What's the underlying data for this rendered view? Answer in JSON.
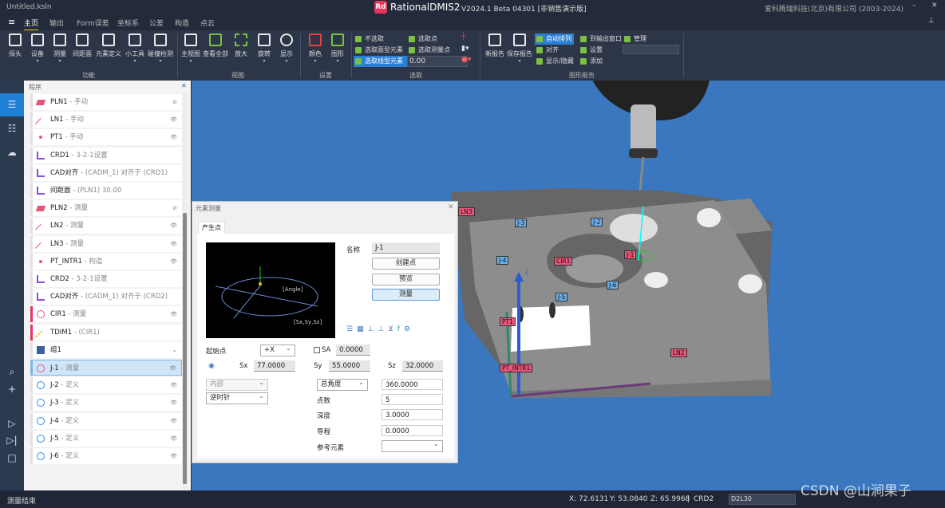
{
  "window": {
    "file": "Untitled.ksln",
    "app": "RationalDMIS2",
    "version": "V2024.1 Beta 04301 [非销售演示版]",
    "company": "爱科腾瑞科技(北京)有限公司 (2003-2024)",
    "minimize": "–",
    "close": "✕"
  },
  "menu": {
    "tabs": [
      "主页",
      "输出",
      "Form误差",
      "坐标系",
      "公差",
      "构造",
      "点云"
    ],
    "active": 0
  },
  "ribbon": {
    "groups": [
      {
        "label": "功能",
        "buttons": [
          "探头",
          "设备",
          "测量",
          "间距面",
          "元素定义",
          "小工具",
          "碰撞检测"
        ]
      },
      {
        "label": "视图",
        "buttons": [
          "主视图",
          "查看全部",
          "放大",
          "旋转",
          "显示"
        ]
      },
      {
        "label": "设置",
        "buttons": [
          "颜色",
          "图形"
        ]
      },
      {
        "label": "选取",
        "items": [
          "不选取",
          "选取点",
          "选取面型元素",
          "选取测量点",
          "选取线型元素"
        ],
        "value": "0.00"
      },
      {
        "label": "图形报告",
        "buttons": [
          "新报告",
          "保存报告"
        ],
        "items": [
          "自动排列",
          "到输出窗口",
          "管理",
          "对齐",
          "设置",
          "显示/隐藏",
          "添加"
        ]
      }
    ]
  },
  "panel": {
    "title": "程序",
    "close": "✕",
    "items": [
      {
        "name": "PLN1",
        "desc": " - 手动",
        "icon": "plane-icon",
        "color": "#e8557a",
        "eye": "hidden"
      },
      {
        "name": "LN1",
        "desc": " - 手动",
        "icon": "line-icon",
        "color": "#e8557a",
        "eye": "visible"
      },
      {
        "name": "PT1",
        "desc": " - 手动",
        "icon": "point-icon",
        "color": "#e8557a",
        "eye": "visible"
      },
      {
        "name": "CRD1",
        "desc": " - 3-2-1设置",
        "icon": "axes-icon",
        "color": "#8a4fe0"
      },
      {
        "name": "CAD对齐",
        "desc": " - (CADM_1) 对齐于 (CRD1)",
        "icon": "cad-align-icon",
        "color": "#8a4fe0"
      },
      {
        "name": "间距面",
        "desc": " - (PLN1) 30.00",
        "icon": "offset-plane-icon",
        "color": "#8a4fe0"
      },
      {
        "name": "PLN2",
        "desc": " - 测量",
        "icon": "plane-icon",
        "color": "#e8557a",
        "eye": "hidden"
      },
      {
        "name": "LN2",
        "desc": " - 测量",
        "icon": "line-icon",
        "color": "#e8557a",
        "eye": "visible"
      },
      {
        "name": "LN3",
        "desc": " - 测量",
        "icon": "line-icon",
        "color": "#e8557a",
        "eye": "visible"
      },
      {
        "name": "PT_INTR1",
        "desc": " - 构造",
        "icon": "point-icon",
        "color": "#e8557a",
        "eye": "visible"
      },
      {
        "name": "CRD2",
        "desc": " - 3-2-1设置",
        "icon": "axes-icon",
        "color": "#8a4fe0"
      },
      {
        "name": "CAD对齐",
        "desc": " - (CADM_1) 对齐于 (CRD2)",
        "icon": "cad-align-icon",
        "color": "#8a4fe0"
      },
      {
        "name": "CIR1",
        "desc": " - 测量",
        "icon": "circle-icon",
        "color": "#e8557a",
        "eye": "visible",
        "flag": true
      },
      {
        "name": "TDIM1",
        "desc": " - (CIR1)",
        "icon": "ruler-icon",
        "color": "#f0b000",
        "flag": true
      },
      {
        "name": "组1",
        "desc": "",
        "icon": "group-icon",
        "color": "#3b5fa0",
        "chevron": "⌄"
      },
      {
        "name": "J-1",
        "desc": " - 测量",
        "icon": "circle-icon",
        "color": "#e8557a",
        "eye": "visible",
        "active": true
      },
      {
        "name": "J-2",
        "desc": " - 定义",
        "icon": "circle-icon",
        "color": "#2f8fe0",
        "eye": "visible"
      },
      {
        "name": "J-3",
        "desc": " - 定义",
        "icon": "circle-icon",
        "color": "#2f8fe0",
        "eye": "visible"
      },
      {
        "name": "J-4",
        "desc": " - 定义",
        "icon": "circle-icon",
        "color": "#2f8fe0",
        "eye": "visible"
      },
      {
        "name": "J-5",
        "desc": " - 定义",
        "icon": "circle-icon",
        "color": "#2f8fe0",
        "eye": "visible"
      },
      {
        "name": "J-6",
        "desc": " - 定义",
        "icon": "circle-icon",
        "color": "#2f8fe0",
        "eye": "visible"
      }
    ]
  },
  "view": {
    "labels_red": [
      "LN3",
      "CIR1",
      "J-1",
      "PT1",
      "PT_INTR1",
      "LN2"
    ],
    "labels_blue": [
      "J-3",
      "J-2",
      "J-4",
      "J-6",
      "J-5"
    ],
    "axis_z": "Z",
    "background": "#3b77be"
  },
  "dialog": {
    "title": "元素测量",
    "close": "✕",
    "tab": "产生点",
    "preview_angle": "[Angle]",
    "preview_start": "[Sx,Sy,Sz]",
    "name_label": "名称",
    "name_value": "J-1",
    "create_points": "创建点",
    "preview": "预览",
    "measure": "测量",
    "start_label": "起始点",
    "start_value": "+X",
    "sa_label": "SA",
    "sa_value": "0.0000",
    "sx_label": "Sx",
    "sx": "77.0000",
    "sy_label": "Sy",
    "sy": "55.0000",
    "sz_label": "Sz",
    "sz": "32.0000",
    "inside": "内部",
    "direction": "逆时针",
    "angle_mode": "总角度",
    "angle_value": "360.0000",
    "points_label": "点数",
    "points": "5",
    "depth_label": "深度",
    "depth": "3.0000",
    "pitch_label": "导程",
    "pitch": "0.0000",
    "ref_label": "参考元素",
    "ref_value": ""
  },
  "status": {
    "message": "测量结束",
    "x": "X: 72.6131",
    "y": "Y: 53.0840",
    "z": "Z: 65.9968",
    "sep": "|",
    "crd": "CRD2",
    "probe": "D2L30",
    "watermark": "CSDN @山涧果子"
  }
}
